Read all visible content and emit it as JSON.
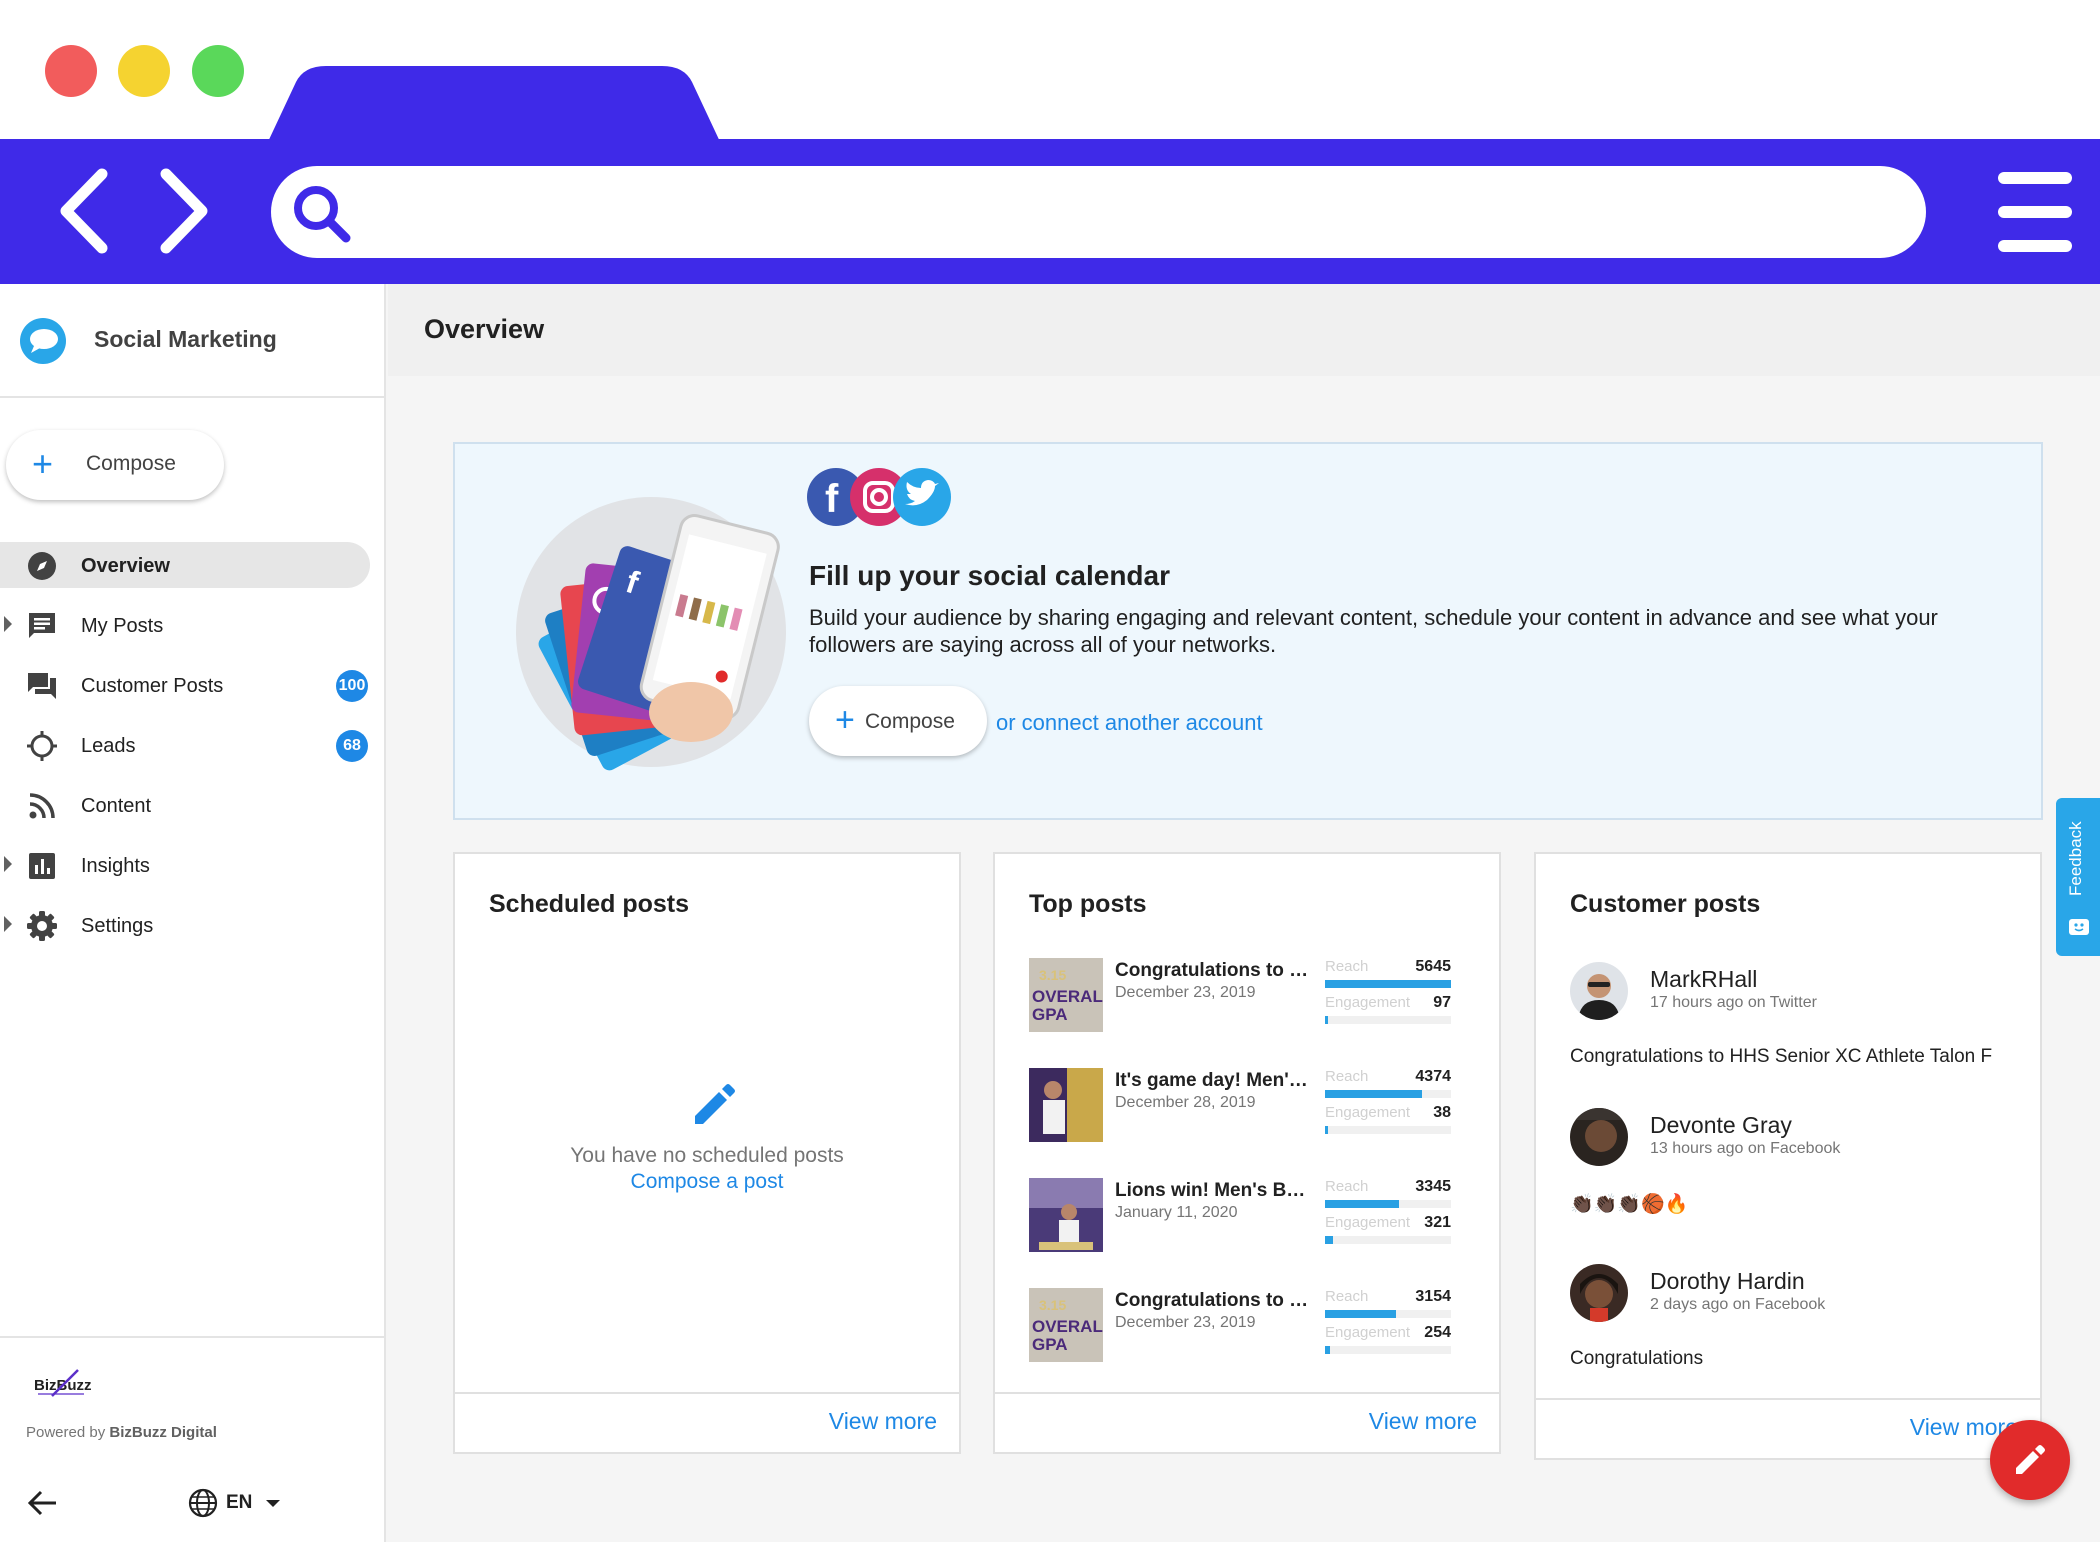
{
  "browser": {
    "search_placeholder": "",
    "colors": {
      "chrome": "#3f2ae8",
      "close": "#f25c5c",
      "minimize": "#f5d330",
      "maximize": "#5ad85a"
    }
  },
  "sidebar": {
    "brand": "Social Marketing",
    "compose_label": "Compose",
    "items": [
      {
        "label": "Overview",
        "icon": "compass-icon",
        "active": true
      },
      {
        "label": "My Posts",
        "icon": "posts-icon"
      },
      {
        "label": "Customer Posts",
        "icon": "chat-icon",
        "badge": "100"
      },
      {
        "label": "Leads",
        "icon": "crosshair-icon",
        "badge": "68"
      },
      {
        "label": "Content",
        "icon": "rss-icon"
      },
      {
        "label": "Insights",
        "icon": "bar-chart-icon"
      },
      {
        "label": "Settings",
        "icon": "gear-icon"
      }
    ],
    "footer": {
      "logo_text": "BizBuzz",
      "powered_prefix": "Powered by",
      "powered_name": "BizBuzz Digital",
      "language": "EN"
    }
  },
  "header": {
    "title": "Overview"
  },
  "hero": {
    "title": "Fill up your social calendar",
    "description": "Build your audience by sharing engaging and relevant content, schedule your content in advance and see what your followers are saying across all of your networks.",
    "compose_label": "Compose",
    "connect_link": "or connect another account"
  },
  "scheduled": {
    "title": "Scheduled posts",
    "empty_text": "You have no scheduled posts",
    "compose_link": "Compose a post",
    "view_more": "View more"
  },
  "top_posts": {
    "title": "Top posts",
    "reach_label": "Reach",
    "engagement_label": "Engagement",
    "view_more": "View more",
    "items": [
      {
        "title": "Congratulations to o...",
        "date": "December 23, 2019",
        "reach": "5645",
        "engagement": "97",
        "reach_pct": 100,
        "engagement_pct": 2
      },
      {
        "title": "It's game day! Men's ...",
        "date": "December 28, 2019",
        "reach": "4374",
        "engagement": "38",
        "reach_pct": 77,
        "engagement_pct": 1
      },
      {
        "title": "Lions win! Men's Bas...",
        "date": "January 11, 2020",
        "reach": "3345",
        "engagement": "321",
        "reach_pct": 59,
        "engagement_pct": 6
      },
      {
        "title": "Congratulations to o...",
        "date": "December 23, 2019",
        "reach": "3154",
        "engagement": "254",
        "reach_pct": 56,
        "engagement_pct": 4
      }
    ]
  },
  "customer_posts": {
    "title": "Customer posts",
    "view_more": "View more",
    "items": [
      {
        "name": "MarkRHall",
        "meta": "17 hours ago on Twitter",
        "text": "Congratulations to HHS Senior XC Athlete Talon F"
      },
      {
        "name": "Devonte Gray",
        "meta": "13 hours ago on Facebook",
        "text": "👏🏿👏🏿👏🏿🏀🔥"
      },
      {
        "name": "Dorothy Hardin",
        "meta": "2 days ago on Facebook",
        "text": "Congratulations"
      }
    ]
  },
  "feedback": {
    "label": "Feedback"
  }
}
